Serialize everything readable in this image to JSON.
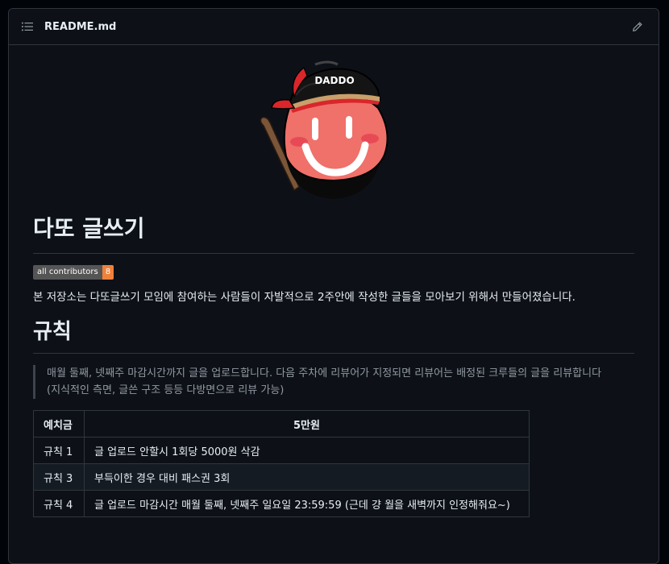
{
  "header": {
    "file_name": "README.md",
    "list_icon": "list-unordered-icon",
    "edit_icon": "pencil-icon"
  },
  "mascot": {
    "cap_text": "DADDO"
  },
  "readme": {
    "title": "다또 글쓰기",
    "badge": {
      "label": "all contributors",
      "count": "8"
    },
    "intro": "본 저장소는 다또글쓰기 모임에 참여하는 사람들이 자발적으로 2주안에 작성한 글들을 모아보기 위해서 만들어졌습니다.",
    "rules_heading": "규칙",
    "quote_line1": "매월 둘째, 넷째주 마감시간까지 글을 업로드합니다. 다음 주차에 리뷰어가 지정되면 리뷰어는 배정된 크루들의 글을 리뷰합니다",
    "quote_line2": "(지식적인 측면, 글쓴 구조 등등 다방면으로 리뷰 가능)",
    "table": {
      "headers": [
        "예치금",
        "5만원"
      ],
      "rows": [
        [
          "규칙 1",
          "글 업로드 안할시 1회당 5000원 삭감"
        ],
        [
          "규칙 3",
          "부득이한 경우 대비 패스권 3회"
        ],
        [
          "규칙 4",
          "글 업로드 마감시간 매월 둘째, 넷째주 일요일 23:59:59 (근데 걍 월을 새벽까지 인정해줘요~)"
        ]
      ]
    }
  },
  "colors": {
    "background": "#0d1117",
    "border": "#30363d",
    "text": "#e6edf3",
    "muted": "#9198a1",
    "badge_count_bg": "#f0813a",
    "face": "#f0706a",
    "cap_red": "#d9262b"
  }
}
